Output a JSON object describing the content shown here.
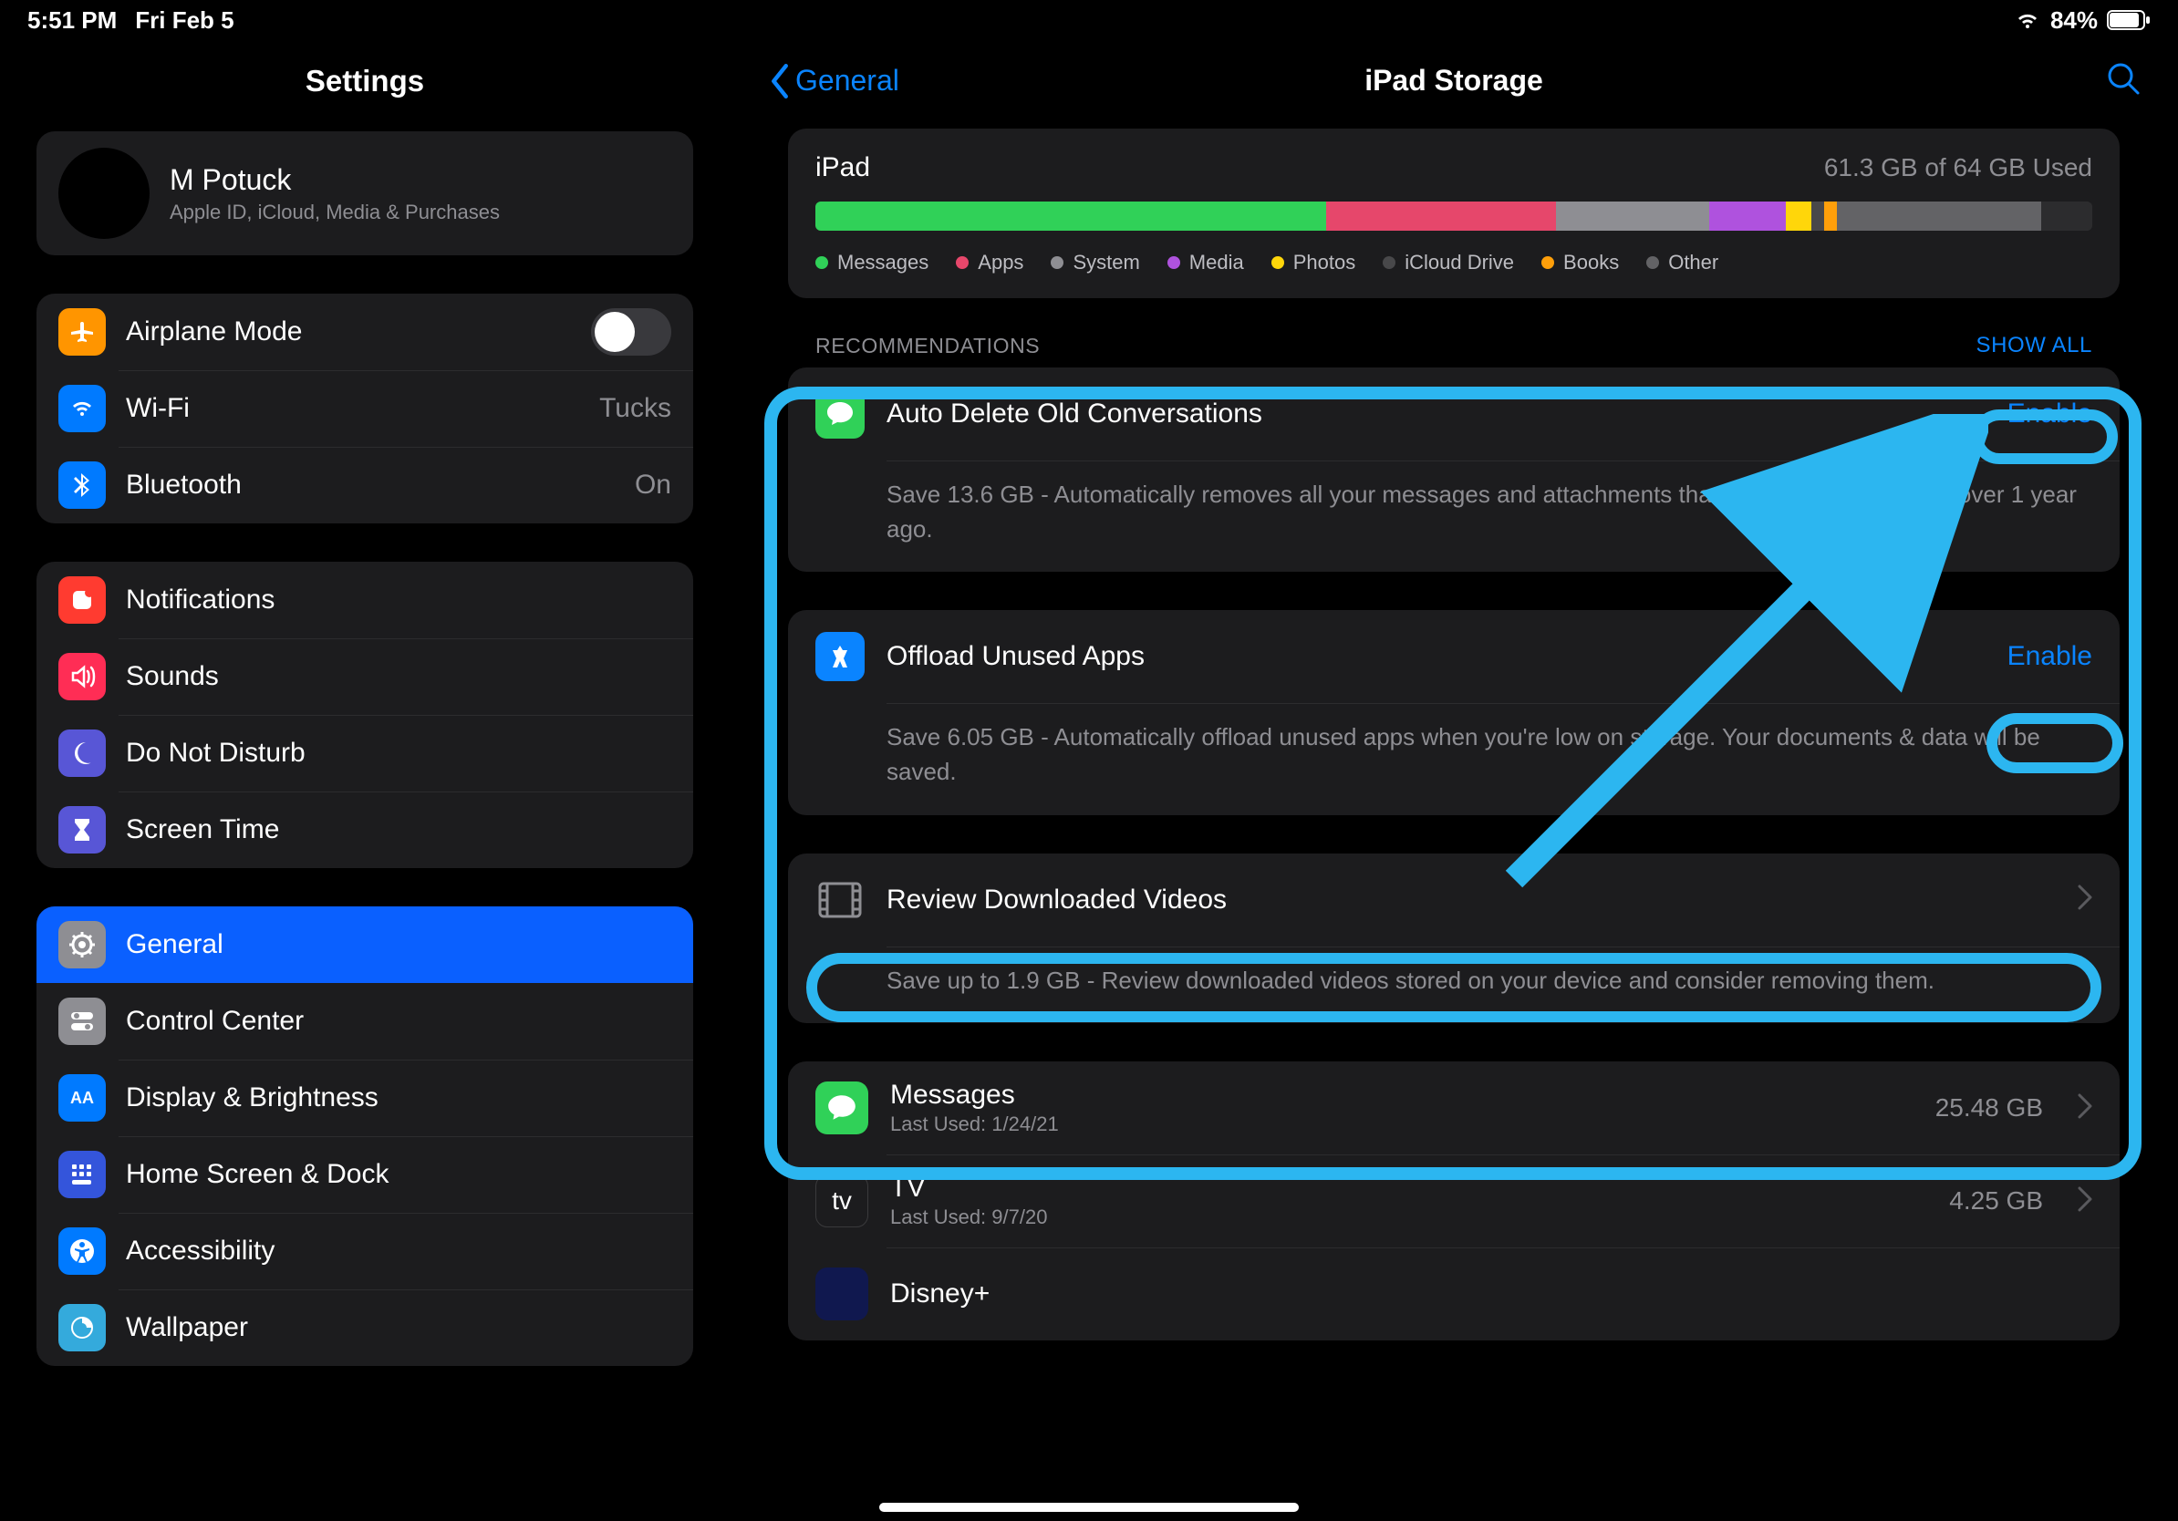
{
  "status": {
    "time": "5:51 PM",
    "date": "Fri Feb 5",
    "battery": "84%"
  },
  "sidebar": {
    "title": "Settings",
    "account": {
      "name": "M Potuck",
      "subtitle": "Apple ID, iCloud, Media & Purchases"
    },
    "group1": {
      "airplane": "Airplane Mode",
      "wifi": "Wi-Fi",
      "wifi_value": "Tucks",
      "bluetooth": "Bluetooth",
      "bluetooth_value": "On"
    },
    "group2": {
      "notifications": "Notifications",
      "sounds": "Sounds",
      "dnd": "Do Not Disturb",
      "screen_time": "Screen Time"
    },
    "group3": {
      "general": "General",
      "control_center": "Control Center",
      "display": "Display & Brightness",
      "home": "Home Screen & Dock",
      "accessibility": "Accessibility",
      "wallpaper": "Wallpaper"
    }
  },
  "detail": {
    "back": "General",
    "title": "iPad Storage",
    "storage": {
      "device": "iPad",
      "used": "61.3 GB of 64 GB Used",
      "segments": [
        {
          "name": "Messages",
          "color": "#30d158",
          "pct": 40
        },
        {
          "name": "Apps",
          "color": "#e6476b",
          "pct": 18
        },
        {
          "name": "System",
          "color": "#8e8e93",
          "pct": 12
        },
        {
          "name": "Media",
          "color": "#af52de",
          "pct": 6
        },
        {
          "name": "Photos",
          "color": "#ffd60a",
          "pct": 2
        },
        {
          "name": "iCloud Drive",
          "color": "#48484a",
          "pct": 1
        },
        {
          "name": "Books",
          "color": "#ff9f0a",
          "pct": 1
        },
        {
          "name": "Other",
          "color": "#636366",
          "pct": 16
        }
      ]
    },
    "recommendations": {
      "header": "RECOMMENDATIONS",
      "show_all": "SHOW ALL",
      "items": [
        {
          "icon": "messages",
          "title": "Auto Delete Old Conversations",
          "action": "Enable",
          "desc": "Save 13.6 GB - Automatically removes all your messages and attachments that were sent or received over 1 year ago."
        },
        {
          "icon": "appstore",
          "title": "Offload Unused Apps",
          "action": "Enable",
          "desc": "Save 6.05 GB - Automatically offload unused apps when you're low on storage. Your documents & data will be saved."
        },
        {
          "icon": "video",
          "title": "Review Downloaded Videos",
          "action": "chevron",
          "desc": "Save up to 1.9 GB - Review downloaded videos stored on your device and consider removing them."
        }
      ]
    },
    "apps": [
      {
        "name": "Messages",
        "sub": "Last Used: 1/24/21",
        "size": "25.48 GB",
        "icon": "messages"
      },
      {
        "name": "TV",
        "sub": "Last Used: 9/7/20",
        "size": "4.25 GB",
        "icon": "tv"
      },
      {
        "name": "Disney+",
        "sub": "",
        "size": "",
        "icon": "disney"
      }
    ]
  }
}
